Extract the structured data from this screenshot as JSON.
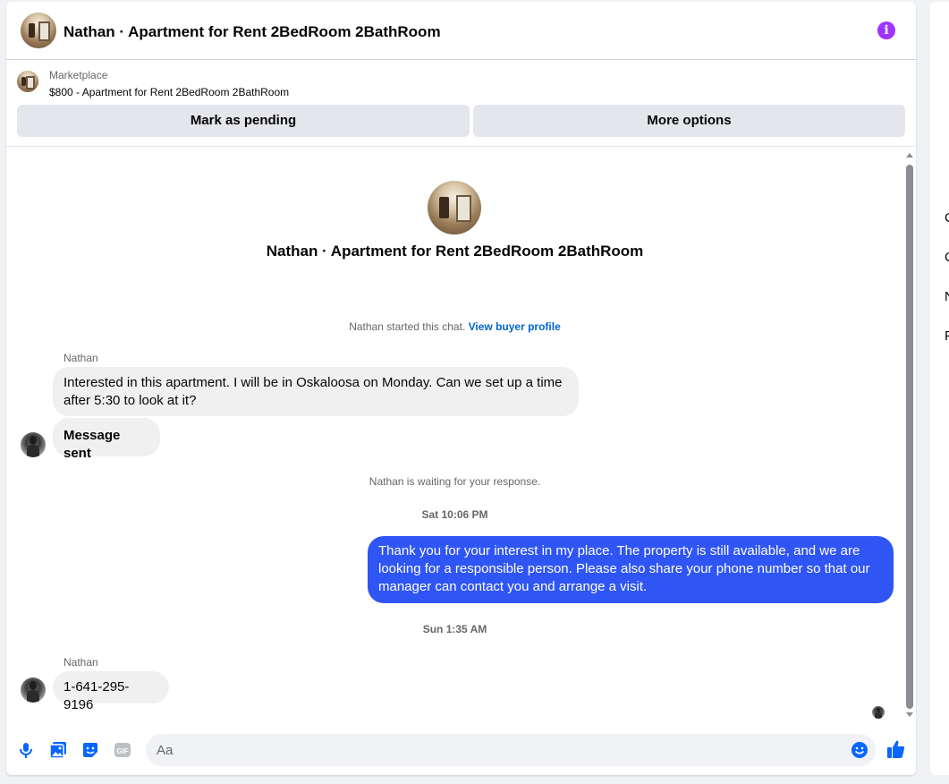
{
  "header": {
    "title": "Nathan · Apartment for Rent 2BedRoom 2BathRoom",
    "info_icon": "info-icon",
    "info_glyph": "i",
    "accent": "#a033ff"
  },
  "listing": {
    "source": "Marketplace",
    "title": "$800 - Apartment for Rent 2BedRoom 2BathRoom",
    "buttons": {
      "pending": "Mark as pending",
      "more": "More options"
    }
  },
  "conversation": {
    "intro_title": "Nathan · Apartment for Rent 2BedRoom 2BathRoom",
    "started_text": "Nathan started this chat.",
    "profile_link": "View buyer profile",
    "messages": [
      {
        "sender": "Nathan",
        "text": "Interested in this apartment. I will be in Oskaloosa on Monday. Can we set up a time after 5:30 to look at it?"
      },
      {
        "sender": "",
        "text": "Message sent"
      },
      {
        "sender": "",
        "text": "Thank you for your interest in my place. The property is still available, and we are looking for a responsible person. Please also share your phone number so that our manager can contact you and arrange a visit."
      },
      {
        "sender": "Nathan",
        "text": "1-641-295-9196"
      }
    ],
    "waiting_text": "Nathan is waiting for your response.",
    "timestamps": [
      "Sat 10:06 PM",
      "Sun 1:35 AM"
    ],
    "outgoing_color": "#2f55f5",
    "incoming_color": "#f0f0f0"
  },
  "composer": {
    "placeholder": "Aa",
    "icons": [
      "microphone-icon",
      "photo-icon",
      "sticker-icon",
      "gif-icon",
      "emoji-icon",
      "thumbs-up-icon"
    ],
    "gif_label": "GIF",
    "accent": "#0866ff"
  },
  "right_panel": {
    "items": [
      "C",
      "C",
      "N",
      "P"
    ]
  }
}
